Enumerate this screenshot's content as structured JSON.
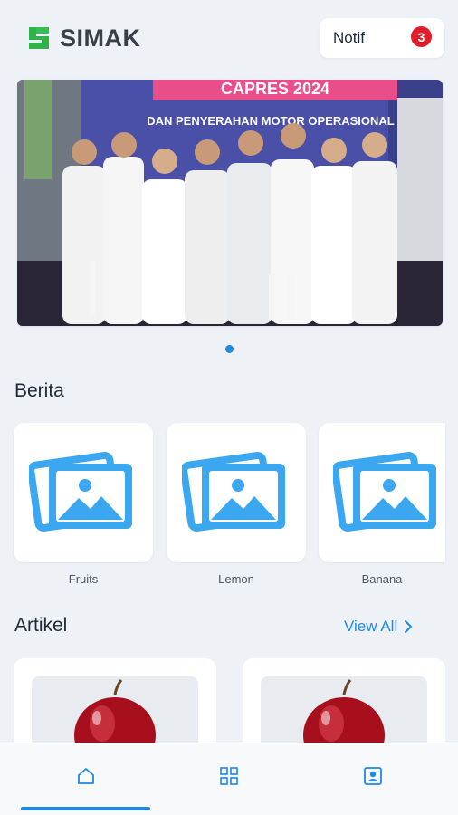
{
  "app": {
    "name": "SIMAK",
    "brand_color": "#2db34a",
    "accent_color": "#1e88e5"
  },
  "header": {
    "notif_label": "Notif",
    "notif_count": "3"
  },
  "banner": {
    "headline_top": "CAPRES 2024",
    "headline_bottom": "DAN PENYERAHAN MOTOR OPERASIONAL",
    "active_slide": 1,
    "total_slides": 1
  },
  "berita": {
    "title": "Berita",
    "items": [
      {
        "caption": "Fruits",
        "icon": "image-placeholder-icon"
      },
      {
        "caption": "Lemon",
        "icon": "image-placeholder-icon"
      },
      {
        "caption": "Banana",
        "icon": "image-placeholder-icon"
      }
    ]
  },
  "artikel": {
    "title": "Artikel",
    "view_all": "View All",
    "items": [
      {
        "image": "apple"
      },
      {
        "image": "apple"
      }
    ]
  },
  "bottom_nav": {
    "items": [
      {
        "icon": "home-icon",
        "active": true
      },
      {
        "icon": "grid-icon",
        "active": false
      },
      {
        "icon": "profile-icon",
        "active": false
      }
    ]
  }
}
